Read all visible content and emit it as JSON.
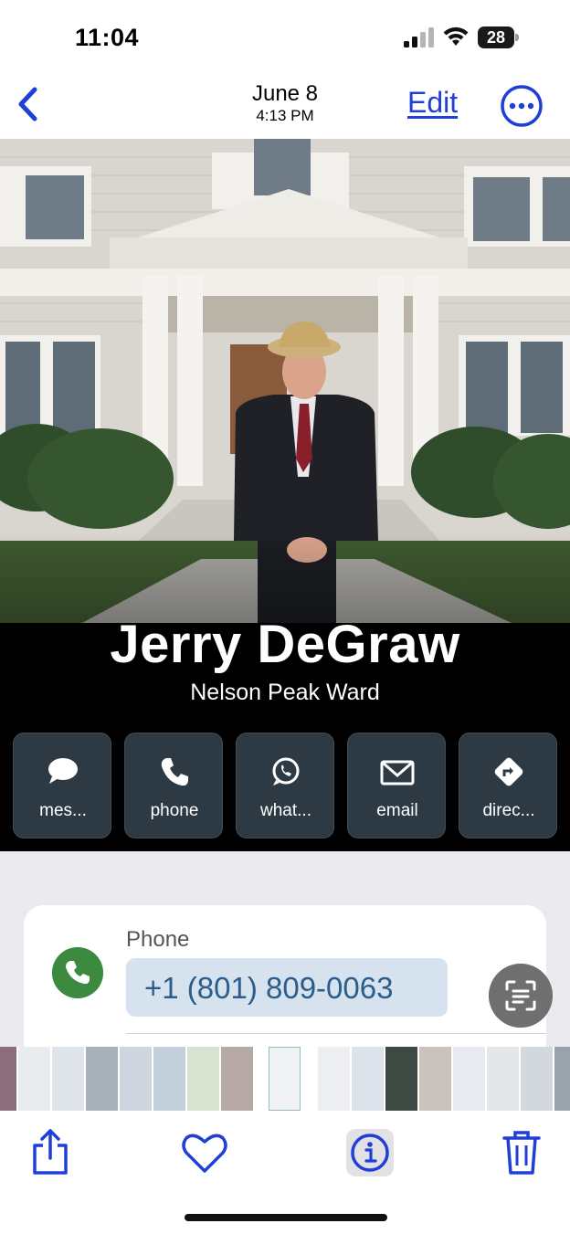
{
  "status_bar": {
    "time": "11:04",
    "battery_level": "28"
  },
  "nav": {
    "date": "June 8",
    "time": "4:13 PM",
    "edit_label": "Edit",
    "back_icon": "chevron-left-icon",
    "more_icon": "ellipsis-circle-icon"
  },
  "contact": {
    "name": "Jerry DeGraw",
    "subtitle": "Nelson Peak Ward"
  },
  "actions": [
    {
      "label": "mes...",
      "icon": "message-bubble-icon"
    },
    {
      "label": "phone",
      "icon": "phone-icon"
    },
    {
      "label": "what...",
      "icon": "whatsapp-icon"
    },
    {
      "label": "email",
      "icon": "envelope-icon"
    },
    {
      "label": "direc...",
      "icon": "directions-icon"
    }
  ],
  "phone_card": {
    "label": "Phone",
    "number": "+1 (801) 809-0063"
  },
  "colors": {
    "accent": "#1f3fd6",
    "action_tile": "#2e3a43",
    "phone_green": "#3c8a3f",
    "pill_bg": "#d6e3ee",
    "pill_text": "#2c5d8a"
  },
  "toolbar": {
    "share_icon": "share-icon",
    "favorite_icon": "heart-icon",
    "info_icon": "info-icon",
    "delete_icon": "trash-icon"
  }
}
